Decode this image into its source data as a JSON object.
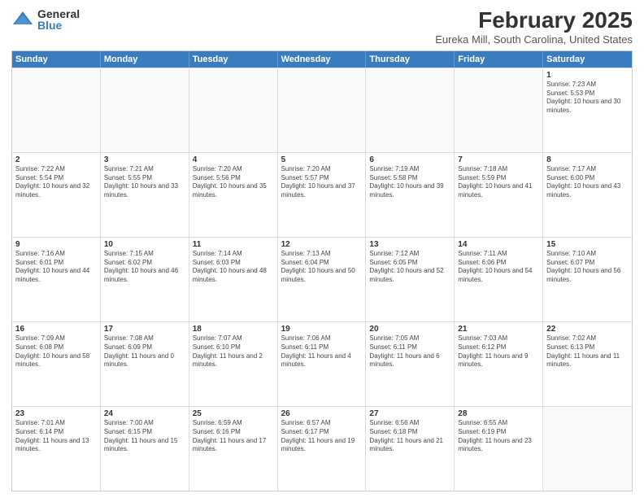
{
  "logo": {
    "general": "General",
    "blue": "Blue"
  },
  "header": {
    "month": "February 2025",
    "location": "Eureka Mill, South Carolina, United States"
  },
  "weekdays": [
    "Sunday",
    "Monday",
    "Tuesday",
    "Wednesday",
    "Thursday",
    "Friday",
    "Saturday"
  ],
  "weeks": [
    [
      {
        "day": "",
        "info": ""
      },
      {
        "day": "",
        "info": ""
      },
      {
        "day": "",
        "info": ""
      },
      {
        "day": "",
        "info": ""
      },
      {
        "day": "",
        "info": ""
      },
      {
        "day": "",
        "info": ""
      },
      {
        "day": "1",
        "info": "Sunrise: 7:23 AM\nSunset: 5:53 PM\nDaylight: 10 hours and 30 minutes."
      }
    ],
    [
      {
        "day": "2",
        "info": "Sunrise: 7:22 AM\nSunset: 5:54 PM\nDaylight: 10 hours and 32 minutes."
      },
      {
        "day": "3",
        "info": "Sunrise: 7:21 AM\nSunset: 5:55 PM\nDaylight: 10 hours and 33 minutes."
      },
      {
        "day": "4",
        "info": "Sunrise: 7:20 AM\nSunset: 5:56 PM\nDaylight: 10 hours and 35 minutes."
      },
      {
        "day": "5",
        "info": "Sunrise: 7:20 AM\nSunset: 5:57 PM\nDaylight: 10 hours and 37 minutes."
      },
      {
        "day": "6",
        "info": "Sunrise: 7:19 AM\nSunset: 5:58 PM\nDaylight: 10 hours and 39 minutes."
      },
      {
        "day": "7",
        "info": "Sunrise: 7:18 AM\nSunset: 5:59 PM\nDaylight: 10 hours and 41 minutes."
      },
      {
        "day": "8",
        "info": "Sunrise: 7:17 AM\nSunset: 6:00 PM\nDaylight: 10 hours and 43 minutes."
      }
    ],
    [
      {
        "day": "9",
        "info": "Sunrise: 7:16 AM\nSunset: 6:01 PM\nDaylight: 10 hours and 44 minutes."
      },
      {
        "day": "10",
        "info": "Sunrise: 7:15 AM\nSunset: 6:02 PM\nDaylight: 10 hours and 46 minutes."
      },
      {
        "day": "11",
        "info": "Sunrise: 7:14 AM\nSunset: 6:03 PM\nDaylight: 10 hours and 48 minutes."
      },
      {
        "day": "12",
        "info": "Sunrise: 7:13 AM\nSunset: 6:04 PM\nDaylight: 10 hours and 50 minutes."
      },
      {
        "day": "13",
        "info": "Sunrise: 7:12 AM\nSunset: 6:05 PM\nDaylight: 10 hours and 52 minutes."
      },
      {
        "day": "14",
        "info": "Sunrise: 7:11 AM\nSunset: 6:06 PM\nDaylight: 10 hours and 54 minutes."
      },
      {
        "day": "15",
        "info": "Sunrise: 7:10 AM\nSunset: 6:07 PM\nDaylight: 10 hours and 56 minutes."
      }
    ],
    [
      {
        "day": "16",
        "info": "Sunrise: 7:09 AM\nSunset: 6:08 PM\nDaylight: 10 hours and 58 minutes."
      },
      {
        "day": "17",
        "info": "Sunrise: 7:08 AM\nSunset: 6:09 PM\nDaylight: 11 hours and 0 minutes."
      },
      {
        "day": "18",
        "info": "Sunrise: 7:07 AM\nSunset: 6:10 PM\nDaylight: 11 hours and 2 minutes."
      },
      {
        "day": "19",
        "info": "Sunrise: 7:06 AM\nSunset: 6:11 PM\nDaylight: 11 hours and 4 minutes."
      },
      {
        "day": "20",
        "info": "Sunrise: 7:05 AM\nSunset: 6:11 PM\nDaylight: 11 hours and 6 minutes."
      },
      {
        "day": "21",
        "info": "Sunrise: 7:03 AM\nSunset: 6:12 PM\nDaylight: 11 hours and 9 minutes."
      },
      {
        "day": "22",
        "info": "Sunrise: 7:02 AM\nSunset: 6:13 PM\nDaylight: 11 hours and 11 minutes."
      }
    ],
    [
      {
        "day": "23",
        "info": "Sunrise: 7:01 AM\nSunset: 6:14 PM\nDaylight: 11 hours and 13 minutes."
      },
      {
        "day": "24",
        "info": "Sunrise: 7:00 AM\nSunset: 6:15 PM\nDaylight: 11 hours and 15 minutes."
      },
      {
        "day": "25",
        "info": "Sunrise: 6:59 AM\nSunset: 6:16 PM\nDaylight: 11 hours and 17 minutes."
      },
      {
        "day": "26",
        "info": "Sunrise: 6:57 AM\nSunset: 6:17 PM\nDaylight: 11 hours and 19 minutes."
      },
      {
        "day": "27",
        "info": "Sunrise: 6:56 AM\nSunset: 6:18 PM\nDaylight: 11 hours and 21 minutes."
      },
      {
        "day": "28",
        "info": "Sunrise: 6:55 AM\nSunset: 6:19 PM\nDaylight: 11 hours and 23 minutes."
      },
      {
        "day": "",
        "info": ""
      }
    ]
  ]
}
